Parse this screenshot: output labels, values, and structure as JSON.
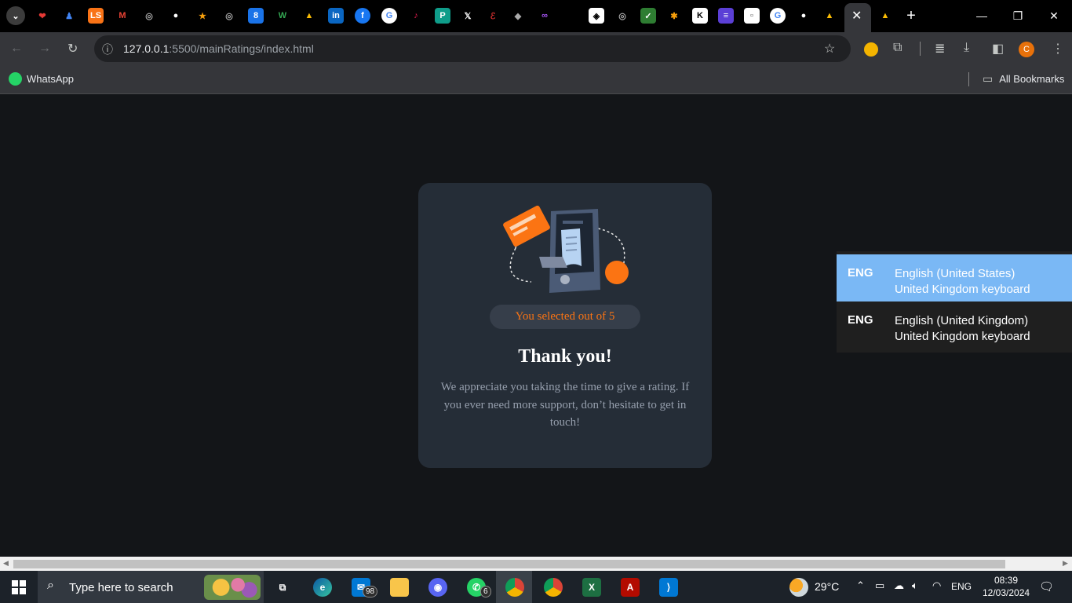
{
  "browser": {
    "url_host": "127.0.0.1",
    "url_path": ":5500/mainRatings/index.html",
    "bookmark_whatsapp": "WhatsApp",
    "all_bookmarks": "All Bookmarks",
    "profile_initial": "C"
  },
  "card": {
    "rating_text": "You selected out of 5",
    "title": "Thank you!",
    "message": "We appreciate you taking the time to give a rating. If you ever need more support, don’t hesitate to get in touch!"
  },
  "language_menu": {
    "items": [
      {
        "code": "ENG",
        "language": "English (United States)",
        "keyboard": "United Kingdom keyboard",
        "selected": true
      },
      {
        "code": "ENG",
        "language": "English (United Kingdom)",
        "keyboard": "United Kingdom keyboard",
        "selected": false
      }
    ]
  },
  "taskbar": {
    "search_placeholder": "Type here to search",
    "mail_badge": "98",
    "whatsapp_badge": "6",
    "weather": "29°C",
    "input_lang": "ENG",
    "time": "08:39",
    "date": "12/03/2024"
  },
  "colors": {
    "accent": "#fb7413",
    "card_bg": "#252d37",
    "page_bg": "#131518",
    "lang_selected": "#7ab8f5"
  }
}
